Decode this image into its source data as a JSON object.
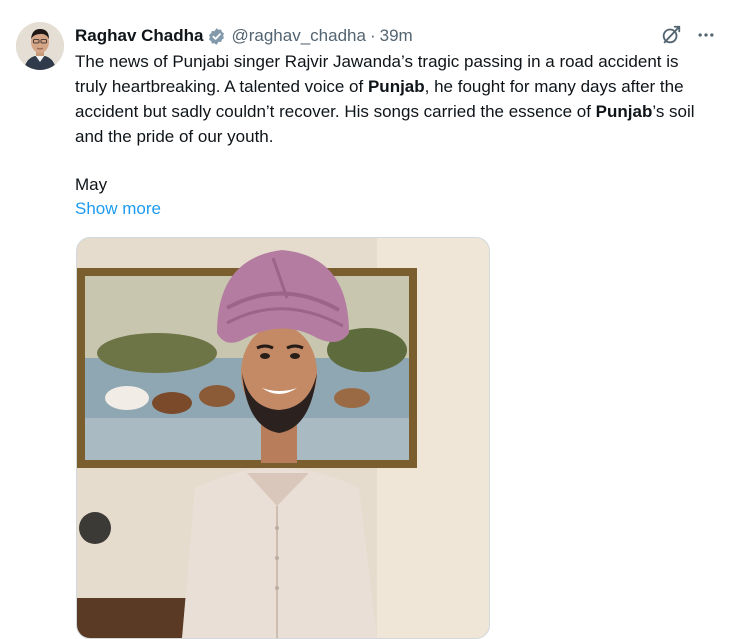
{
  "author": {
    "name": "Raghav Chadha",
    "handle": "@raghav_chadha",
    "separator": "·",
    "time": "39m",
    "verified_color": "#829aab"
  },
  "tweet": {
    "seg1": "The news of Punjabi singer Rajvir Jawanda’s tragic passing in a road accident is truly heartbreaking. A talented voice of ",
    "bold1": "Punjab",
    "seg2": ", he fought for many days after the accident but sadly couldn’t recover. His songs carried the essence of ",
    "bold2": "Punjab",
    "seg3": "’s soil and the pride of our youth.",
    "trailing": "May",
    "show_more": "Show more"
  },
  "icons": {
    "grok": "grok-icon",
    "more": "more-icon",
    "verified": "verified-badge-icon"
  },
  "colors": {
    "link": "#1d9bf0",
    "secondary_text": "#536471",
    "turban": "#b47ca0"
  }
}
